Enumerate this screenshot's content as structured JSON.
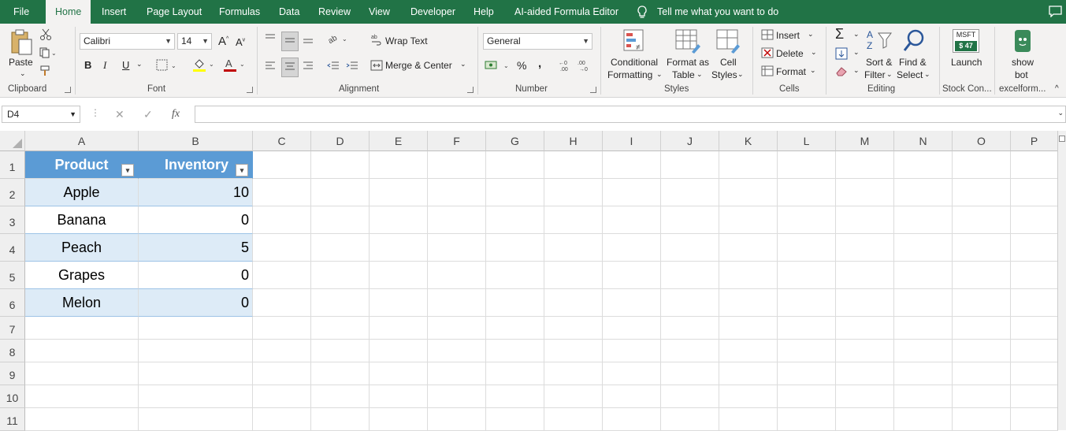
{
  "tabs": [
    "File",
    "Home",
    "Insert",
    "Page Layout",
    "Formulas",
    "Data",
    "Review",
    "View",
    "Developer",
    "Help",
    "AI-aided Formula Editor"
  ],
  "tell_me": "Tell me what you want to do",
  "ribbon": {
    "clipboard": {
      "paste": "Paste",
      "label": "Clipboard"
    },
    "font": {
      "name": "Calibri",
      "size": "14",
      "label": "Font",
      "bold": "B",
      "italic": "I",
      "underline": "U",
      "grow": "A",
      "shrink": "A"
    },
    "alignment": {
      "wrap_text": "Wrap Text",
      "merge_center": "Merge & Center",
      "label": "Alignment"
    },
    "number": {
      "format": "General",
      "percent": "%",
      "comma": ",",
      "label": "Number"
    },
    "styles": {
      "conditional_1": "Conditional",
      "conditional_2": "Formatting",
      "format_table_1": "Format as",
      "format_table_2": "Table",
      "cell_styles_1": "Cell",
      "cell_styles_2": "Styles",
      "label": "Styles"
    },
    "cells": {
      "insert": "Insert",
      "delete": "Delete",
      "format": "Format",
      "label": "Cells"
    },
    "editing": {
      "sort_1": "Sort &",
      "sort_2": "Filter",
      "find_1": "Find &",
      "find_2": "Select",
      "label": "Editing"
    },
    "stock": {
      "ticker": "MSFT",
      "price": "$ 47",
      "launch": "Launch",
      "label": "Stock Con..."
    },
    "bot": {
      "line1": "show",
      "line2": "bot",
      "label": "excelform..."
    }
  },
  "formula_bar": {
    "name_box": "D4",
    "fx": "fx",
    "cancel": "✕",
    "enter": "✓",
    "content": ""
  },
  "columns": [
    "A",
    "B",
    "C",
    "D",
    "E",
    "F",
    "G",
    "H",
    "I",
    "J",
    "K",
    "L",
    "M",
    "N",
    "O",
    "P"
  ],
  "rows": [
    "1",
    "2",
    "3",
    "4",
    "5",
    "6",
    "7",
    "8",
    "9",
    "10",
    "11"
  ],
  "table": {
    "headers": [
      "Product",
      "Inventory"
    ],
    "products": [
      "Apple",
      "Banana",
      "Peach",
      "Grapes",
      "Melon"
    ],
    "inventory": [
      "10",
      "0",
      "5",
      "0",
      "0"
    ]
  },
  "colors": {
    "accent": "#217346",
    "table_header": "#5b9bd5",
    "table_band": "#ddebf7"
  }
}
